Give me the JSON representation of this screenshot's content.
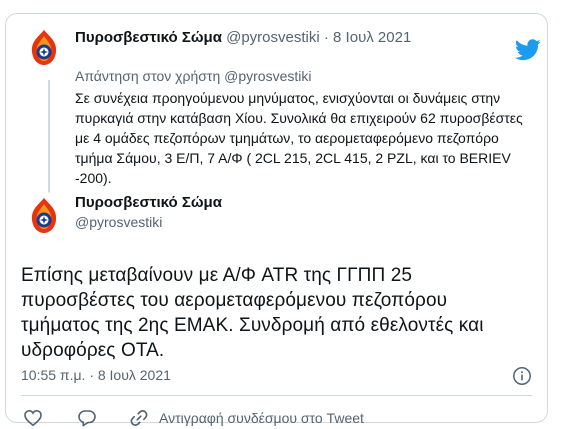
{
  "colors": {
    "twitter_blue": "#1d9bf0",
    "text_primary": "#0f1419",
    "text_secondary": "#536471",
    "border": "#cfd9de"
  },
  "first_tweet": {
    "author_name": "Πυροσβεστικό Σώμα",
    "author_handle": "@pyrosvestiki",
    "separator": "·",
    "date": "8 Ιουλ 2021",
    "reply_to": "Απάντηση στον χρήστη @pyrosvestiki",
    "text": "Σε συνέχεια προηγούμενου μηνύματος, ενισχύονται οι δυνάμεις στην πυρκαγιά στην κατάβαση Χίου. Συνολικά θα επιχειρούν 62 πυροσβέστες με 4 ομάδες πεζοπόρων τμημάτων, το αερομεταφερόμενο πεζοπόρο τμήμα Σάμου, 3 Ε/Π, 7 Α/Φ ( 2CL 215, 2CL 415, 2 PZL, και το BERIEV -200)."
  },
  "main_tweet": {
    "author_name": "Πυροσβεστικό Σώμα",
    "author_handle": "@pyrosvestiki",
    "text": "Επίσης μεταβαίνουν με Α/Φ  ATR  της ΓΓΠΠ 25 πυροσβέστες του αερομεταφερόμενου πεζοπόρου τμήματος της 2ης ΕΜΑΚ. Συνδρομή από εθελοντές και υδροφόρες ΟΤΑ.",
    "timestamp": "10:55 π.μ. · 8 Ιουλ 2021"
  },
  "actions": {
    "copy_link_label": "Αντιγραφή συνδέσμου στο Tweet"
  },
  "icons": [
    "twitter-logo-icon",
    "info-icon",
    "heart-icon",
    "reply-icon",
    "link-icon",
    "fire-brigade-avatar-icon"
  ]
}
